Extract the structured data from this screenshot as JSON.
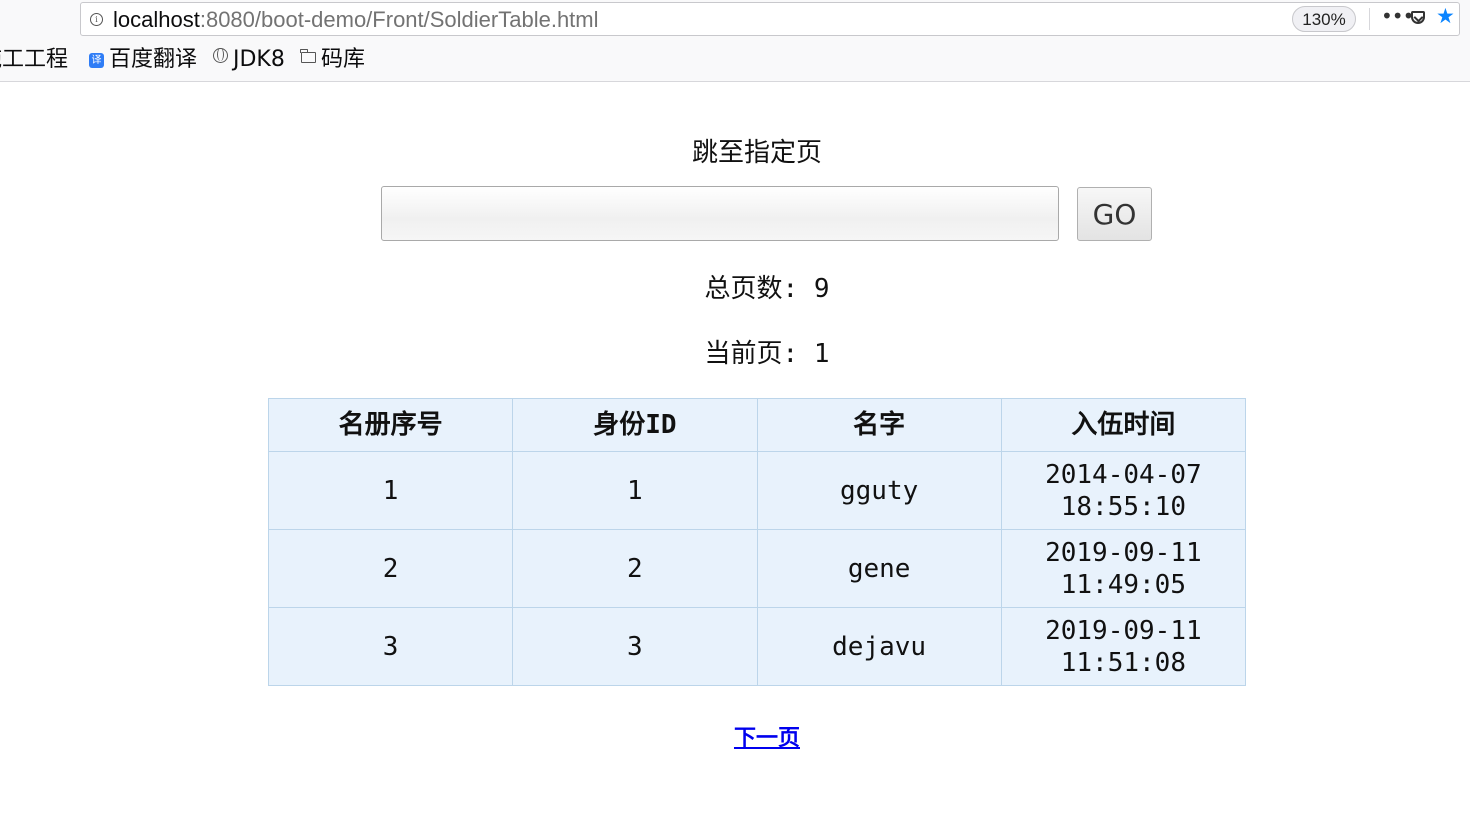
{
  "browser": {
    "url_host": "localhost",
    "url_path": ":8080/boot-demo/Front/SoldierTable.html",
    "zoom": "130%",
    "bookmarks": [
      {
        "label": "施工工程",
        "icon": "none"
      },
      {
        "label": "百度翻译",
        "icon": "baidu-translate-icon",
        "icon_text": "译"
      },
      {
        "label": "JDK8",
        "icon": "globe-icon"
      },
      {
        "label": "码库",
        "icon": "folder-icon"
      }
    ]
  },
  "page": {
    "jump_label": "跳至指定页",
    "jump_input_value": "",
    "go_label": "GO",
    "total_pages_label": "总页数: 9",
    "current_page_label": "当前页: 1",
    "next_page_label": "下一页"
  },
  "table": {
    "headers": [
      "名册序号",
      "身份ID",
      "名字",
      "入伍时间"
    ],
    "rows": [
      {
        "roster_no": "1",
        "id": "1",
        "name": "gguty",
        "date": "2014-04-07",
        "time": "18:55:10"
      },
      {
        "roster_no": "2",
        "id": "2",
        "name": "gene",
        "date": "2019-09-11",
        "time": "11:49:05"
      },
      {
        "roster_no": "3",
        "id": "3",
        "name": "dejavu",
        "date": "2019-09-11",
        "time": "11:51:08"
      }
    ]
  },
  "colors": {
    "table_bg": "#e8f2fc",
    "table_border": "#bcd5ea",
    "link": "#0000ee",
    "accent_star": "#0a84ff"
  }
}
